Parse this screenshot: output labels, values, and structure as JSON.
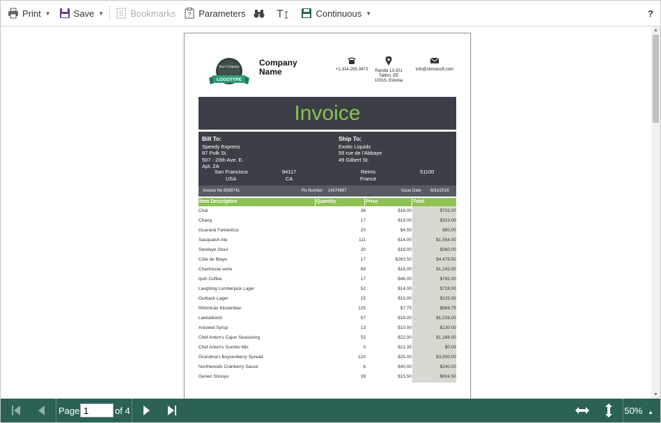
{
  "toolbar": {
    "print_label": "Print",
    "save_label": "Save",
    "bookmarks_label": "Bookmarks",
    "parameters_label": "Parameters",
    "continuous_label": "Continuous",
    "help_label": "?"
  },
  "report": {
    "logo_top_text": "Your Company",
    "logo_ribbon_text": "LOGOTYPE",
    "company_name": "Company Name",
    "phone": "+1-314-255-3473",
    "address_line1": "Randla 13-201",
    "address_line2": "Tallinn, EE",
    "address_line3": "10315, Estonia",
    "email": "info@stimulsoft.com",
    "title": "Invoice",
    "bill_to": {
      "heading": "Bill To:",
      "line1": "Speedy Express",
      "line2": "87 Polk St.",
      "line3": "507 - 20th Ave. E.",
      "line4": "Apt. 2A",
      "city": "San Francisco",
      "zip": "94117",
      "country": "USA",
      "region": "CA"
    },
    "ship_to": {
      "heading": "Ship To:",
      "line1": "Exotic Liquids",
      "line2": "59 rue de l'Abbaye",
      "line3": "49 Gilbert St.",
      "city": "Reims",
      "zip": "51100",
      "country": "France"
    },
    "invoice_no": "Invoice No 8569741",
    "po_number_label": "Po Number",
    "po_number": "14574897",
    "issue_date_label": "Issue Date",
    "issue_date": "8/31/2016",
    "columns": {
      "desc": "Item Description",
      "qty": "Quantity",
      "price": "Price",
      "total": "Total"
    },
    "rows": [
      {
        "desc": "Chai",
        "qty": "36",
        "price": "$18.00",
        "total": "$702.00"
      },
      {
        "desc": "Chang",
        "qty": "17",
        "price": "$19.00",
        "total": "$323.00"
      },
      {
        "desc": "Guaraná Fantástica",
        "qty": "20",
        "price": "$4.50",
        "total": "$90.00"
      },
      {
        "desc": "Sasquatch Ale",
        "qty": "111",
        "price": "$14.00",
        "total": "$1,554.00"
      },
      {
        "desc": "Steeleye Stout",
        "qty": "20",
        "price": "$18.00",
        "total": "$360.00"
      },
      {
        "desc": "Côte de Blaye",
        "qty": "17",
        "price": "$263.50",
        "total": "$4,479.50"
      },
      {
        "desc": "Chartreuse verte",
        "qty": "69",
        "price": "$18.00",
        "total": "$1,242.00"
      },
      {
        "desc": "Ipoh Coffee",
        "qty": "17",
        "price": "$46.00",
        "total": "$782.00"
      },
      {
        "desc": "Laughing Lumberjack Lager",
        "qty": "52",
        "price": "$14.00",
        "total": "$728.00"
      },
      {
        "desc": "Outback Lager",
        "qty": "15",
        "price": "$15.00",
        "total": "$225.00"
      },
      {
        "desc": "Rhönbräu Klosterbier",
        "qty": "125",
        "price": "$7.75",
        "total": "$968.75"
      },
      {
        "desc": "Lakkalikööri",
        "qty": "57",
        "price": "$18.00",
        "total": "$1,026.00"
      },
      {
        "desc": "Aniseed Syrup",
        "qty": "13",
        "price": "$10.00",
        "total": "$130.00"
      },
      {
        "desc": "Chef Anton's Cajun Seasoning",
        "qty": "53",
        "price": "$22.00",
        "total": "$1,166.00"
      },
      {
        "desc": "Chef Anton's Gumbo Mix",
        "qty": "0",
        "price": "$21.35",
        "total": "$0.00"
      },
      {
        "desc": "Grandma's Boysenberry Spread",
        "qty": "120",
        "price": "$25.00",
        "total": "$3,000.00"
      },
      {
        "desc": "Northwoods Cranberry Sauce",
        "qty": "6",
        "price": "$40.00",
        "total": "$240.00"
      },
      {
        "desc": "Genen Shouyu",
        "qty": "39",
        "price": "$15.50",
        "total": "$604.50"
      }
    ]
  },
  "pager": {
    "page_label": "Page",
    "current_page": "1",
    "of_label": "of 4",
    "zoom": "50%"
  },
  "colors": {
    "accent_green": "#8dc152",
    "band_dark": "#3b3f45",
    "footer_bar": "#2b6255"
  }
}
